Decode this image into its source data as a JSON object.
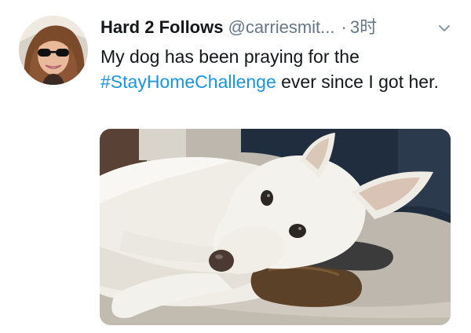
{
  "tweet": {
    "display_name": "Hard 2 Follows",
    "handle": "@carriesmit...",
    "separator": "·",
    "timestamp": "3时",
    "text_before": "My dog has been praying for the ",
    "hashtag": "#StayHomeChallenge",
    "text_after": " ever since I got her."
  },
  "icons": {
    "menu": "chevron-down-icon",
    "avatar": "profile-photo",
    "media": "dog-photo"
  },
  "colors": {
    "text": "#14171a",
    "muted": "#657786",
    "link": "#1b95e0"
  }
}
